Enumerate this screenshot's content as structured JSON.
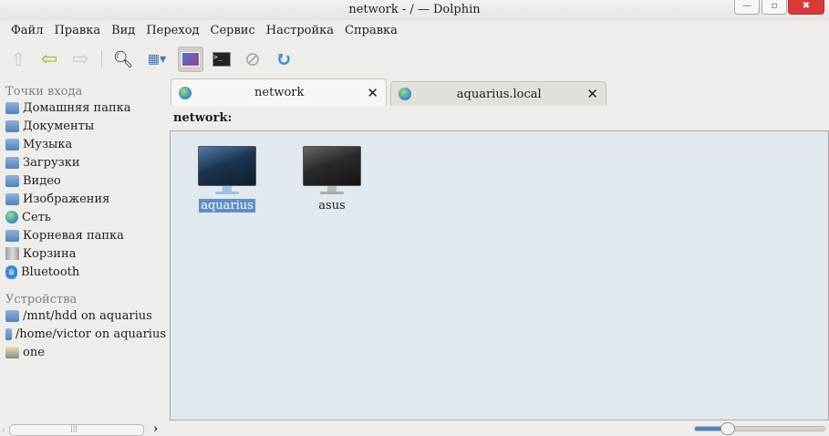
{
  "window": {
    "title": "network - / — Dolphin"
  },
  "menu": [
    "Файл",
    "Правка",
    "Вид",
    "Переход",
    "Сервис",
    "Настройка",
    "Справка"
  ],
  "sidebar": {
    "places_title": "Точки входа",
    "places": [
      "Домашняя папка",
      "Документы",
      "Музыка",
      "Загрузки",
      "Видео",
      "Изображения",
      "Сеть",
      "Корневая папка",
      "Корзина",
      "Bluetooth"
    ],
    "devices_title": "Устройства",
    "devices": [
      "/mnt/hdd on aquarius",
      "/home/victor on aquarius",
      "one"
    ]
  },
  "tabs": [
    {
      "label": "network"
    },
    {
      "label": "aquarius.local"
    }
  ],
  "location": "network:",
  "entries": [
    {
      "name": "aquarius",
      "selected": true
    },
    {
      "name": "asus",
      "selected": false
    }
  ],
  "zoom_level_fraction": 0.25
}
